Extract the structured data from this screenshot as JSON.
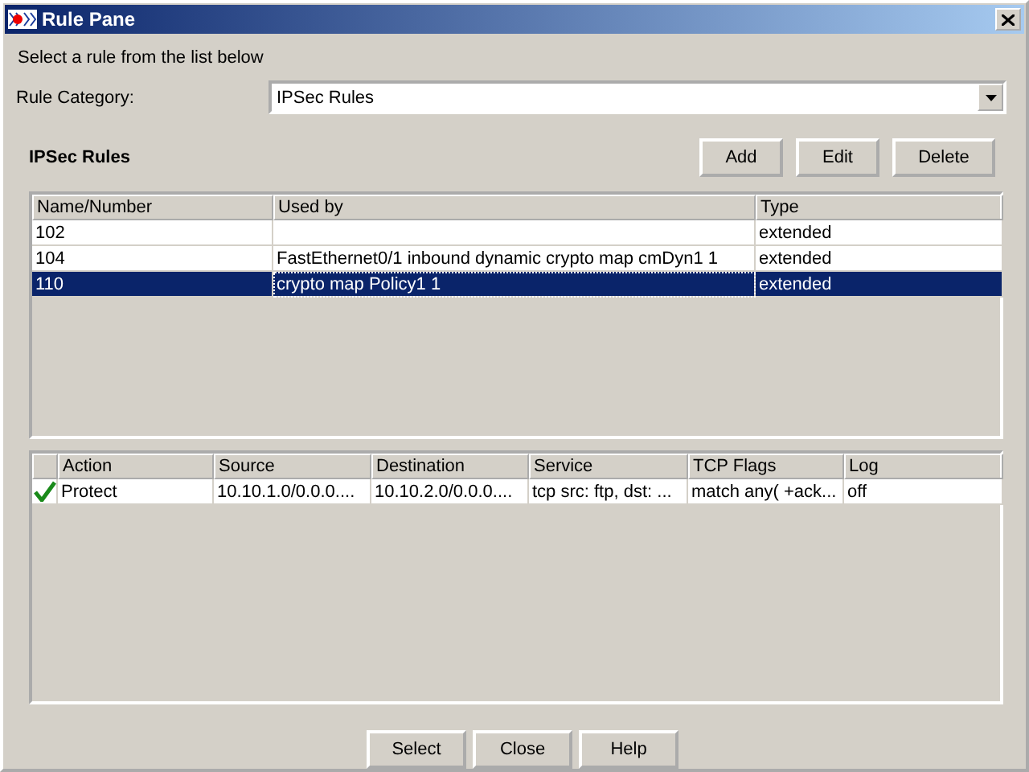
{
  "window": {
    "title": "Rule Pane"
  },
  "instruction": "Select a rule from the list below",
  "category": {
    "label": "Rule Category:",
    "value": "IPSec Rules"
  },
  "rules_section": {
    "title": "IPSec Rules",
    "buttons": [
      "Add",
      "Edit",
      "Delete"
    ]
  },
  "rules_table": {
    "columns": [
      "Name/Number",
      "Used by",
      "Type"
    ],
    "rows": [
      {
        "cells": [
          "102",
          "",
          "extended"
        ],
        "selected": false
      },
      {
        "cells": [
          "104",
          "FastEthernet0/1 inbound dynamic crypto map cmDyn1 1",
          "extended"
        ],
        "selected": false
      },
      {
        "cells": [
          "110",
          "crypto map Policy1 1",
          "extended"
        ],
        "selected": true
      }
    ]
  },
  "entries_table": {
    "columns": [
      "Action",
      "Source",
      "Destination",
      "Service",
      "TCP Flags",
      "Log"
    ],
    "rows": [
      {
        "enabled": true,
        "cells": [
          "Protect",
          "10.10.1.0/0.0.0....",
          "10.10.2.0/0.0.0....",
          "tcp src: ftp, dst: ...",
          "match any( +ack...",
          "off"
        ]
      }
    ]
  },
  "buttons": [
    "Select",
    "Close",
    "Help"
  ]
}
